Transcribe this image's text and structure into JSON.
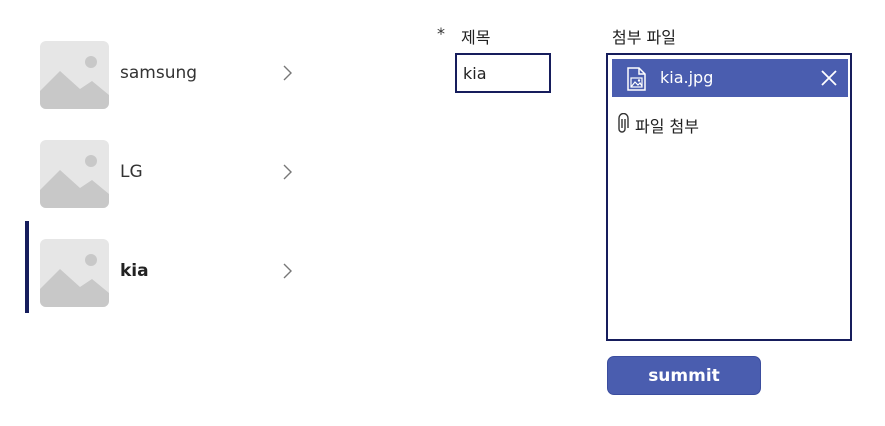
{
  "gallery": {
    "items": [
      {
        "label": "samsung",
        "selected": false
      },
      {
        "label": "LG",
        "selected": false
      },
      {
        "label": "kia",
        "selected": true
      }
    ]
  },
  "form": {
    "title_field": {
      "required_marker": "*",
      "label": "제목",
      "value": "kia"
    },
    "attachments": {
      "label": "첨부 파일",
      "files": [
        {
          "name": "kia.jpg"
        }
      ],
      "add_label": "파일 첨부"
    },
    "submit_label": "summit"
  },
  "icons": {
    "thumbnail": "image-placeholder-icon",
    "chevron": "chevron-right-icon",
    "file": "image-file-icon",
    "remove": "close-icon",
    "attach": "paperclip-icon"
  },
  "colors": {
    "accent": "#4a5daf",
    "border": "#161d5c",
    "placeholder_bg": "#e6e6e6",
    "placeholder_fg": "#c8c8c8"
  }
}
